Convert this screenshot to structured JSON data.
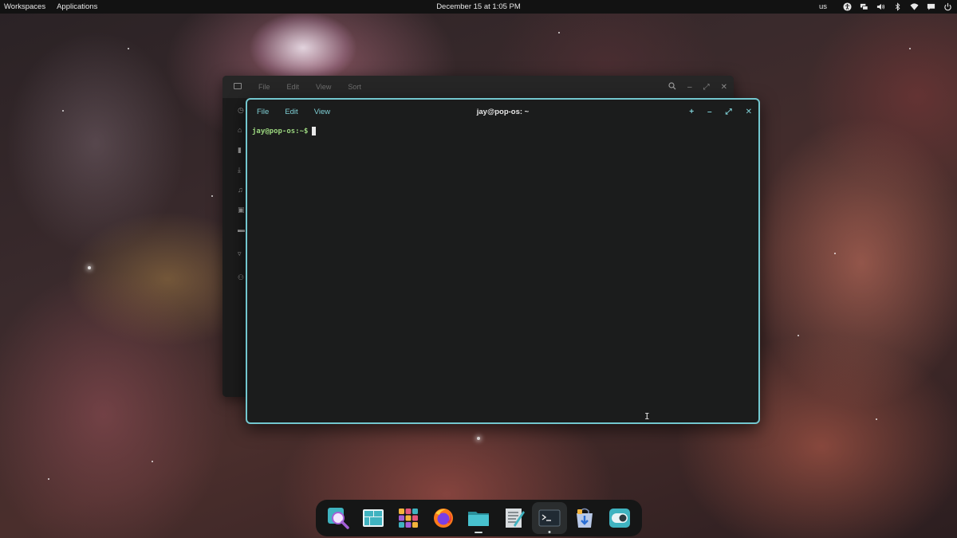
{
  "top_panel": {
    "workspaces": "Workspaces",
    "applications": "Applications",
    "datetime": "December 15 at 1:05 PM",
    "keyboard_layout": "us"
  },
  "files_window": {
    "menu": [
      "File",
      "Edit",
      "View",
      "Sort"
    ]
  },
  "terminal": {
    "menu": [
      "File",
      "Edit",
      "View"
    ],
    "title": "jay@pop-os: ~",
    "prompt": "jay@pop-os:~$",
    "controls": {
      "new_tab": "+",
      "minimize": "–",
      "maximize": "⤢",
      "close": "✕"
    }
  },
  "dock": {
    "items": [
      {
        "name": "search-app",
        "icon": "search-icon"
      },
      {
        "name": "workspaces-app",
        "icon": "workspaces-icon"
      },
      {
        "name": "app-grid",
        "icon": "app-grid-icon"
      },
      {
        "name": "firefox",
        "icon": "firefox-icon"
      },
      {
        "name": "files",
        "icon": "folder-icon",
        "running": true
      },
      {
        "name": "text-editor",
        "icon": "text-editor-icon"
      },
      {
        "name": "terminal",
        "icon": "terminal-icon",
        "running": true,
        "active": true
      },
      {
        "name": "pop-shop",
        "icon": "shop-icon"
      },
      {
        "name": "settings",
        "icon": "toggle-icon"
      }
    ]
  },
  "colors": {
    "accent": "#73c7cf",
    "prompt": "#9bd67f",
    "panel": "#121212",
    "terminal_bg": "#1b1c1c"
  }
}
